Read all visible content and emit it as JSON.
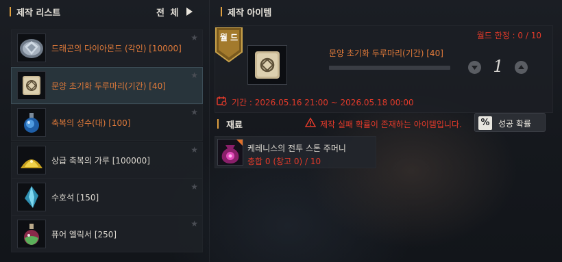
{
  "left_panel": {
    "title": "제작 리스트",
    "filter_label": "전 체",
    "items": [
      {
        "label": "드래곤의 다이아몬드 (각인) [10000]",
        "color": "#e07a3a",
        "icon": "diamond-icon",
        "selected": false
      },
      {
        "label": "문양 초기화 두루마리(기간) [40]",
        "color": "#e07a3a",
        "icon": "scroll-icon",
        "selected": true
      },
      {
        "label": "축복의 성수(대) [100]",
        "color": "#e07a3a",
        "icon": "potion-icon",
        "selected": false
      },
      {
        "label": "상급 축복의 가루 [100000]",
        "color": "#dcd8d0",
        "icon": "powder-icon",
        "selected": false
      },
      {
        "label": "수호석 [150]",
        "color": "#dcd8d0",
        "icon": "crystal-icon",
        "selected": false
      },
      {
        "label": "퓨어 엘릭서 [250]",
        "color": "#dcd8d0",
        "icon": "elixir-icon",
        "selected": false
      }
    ]
  },
  "right_panel": {
    "title": "제작 아이템",
    "badge_label": "월 드",
    "world_limit": "월드 한정 : 0 / 10",
    "item_name": "문양 초기화 두루마리(기간) [40]",
    "progress": 0,
    "quantity": "1",
    "period": "기간 : 2026.05.16 21:00 ~ 2026.05.18 00:00",
    "materials_title": "재료",
    "warning": "제작 실패 확률이 존재하는 아이템입니다.",
    "success_button": {
      "icon_text": "%",
      "label": "성공 확률"
    },
    "material": {
      "name": "케레니스의 전투 스톤 주머니",
      "count": "총합 0 (창고 0) / 10"
    }
  },
  "colors": {
    "accent_bar": "#e0a040",
    "highlight_orange": "#e07a3a",
    "alert_red": "#e23a2a"
  }
}
